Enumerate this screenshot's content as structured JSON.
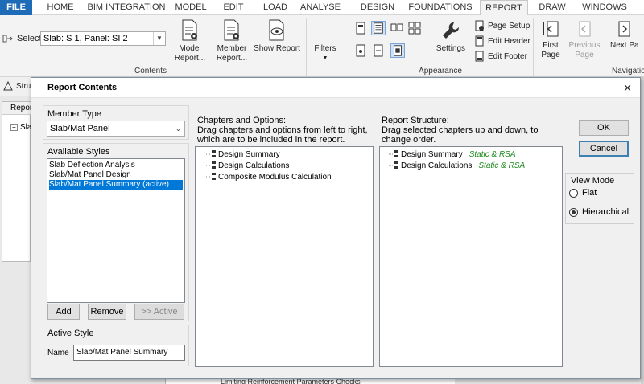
{
  "tabs": [
    "FILE",
    "HOME",
    "BIM INTEGRATION",
    "MODEL",
    "EDIT",
    "LOAD",
    "ANALYSE",
    "DESIGN",
    "FOUNDATIONS",
    "REPORT",
    "DRAW",
    "WINDOWS"
  ],
  "ribbon": {
    "select_label": "Select",
    "select_value": "Slab: S 1, Panel: SI 2",
    "model_report": "Model Report...",
    "member_report": "Member Report...",
    "show_report": "Show Report",
    "contents_group": "Contents",
    "filters": "Filters",
    "settings": "Settings",
    "page_setup": "Page Setup",
    "edit_header": "Edit Header",
    "edit_footer": "Edit Footer",
    "appearance_group": "Appearance",
    "first_page": "First Page",
    "previous_page": "Previous Page",
    "next_page": "Next Pa",
    "navigation_group": "Navigatio"
  },
  "background": {
    "tab_label": "Stru",
    "panel_label": "Repor",
    "tree_item": "Slab",
    "bottom_text": "Limiting Reinforcement Parameters Checks"
  },
  "dialog": {
    "title": "Report Contents",
    "member_type_label": "Member Type",
    "member_type_value": "Slab/Mat Panel",
    "available_styles_label": "Available Styles",
    "styles": [
      "Slab Deflection Analysis",
      "Slab/Mat Panel Design",
      "Slab/Mat Panel Summary (active)"
    ],
    "add": "Add",
    "remove": "Remove",
    "active_btn": ">> Active",
    "active_style_label": "Active Style",
    "name_label": "Name",
    "name_value": "Slab/Mat Panel Summary",
    "chapters_heading": "Chapters and Options:",
    "chapters_desc": "Drag chapters and options from left to right, which are to be included in the report.",
    "chapters": [
      "Design Summary",
      "Design Calculations",
      "Composite Modulus Calculation"
    ],
    "structure_heading": "Report Structure:",
    "structure_desc": "Drag selected chapters up and down, to change order.",
    "structure": [
      {
        "name": "Design Summary",
        "tag": "Static & RSA"
      },
      {
        "name": "Design Calculations",
        "tag": "Static & RSA"
      }
    ],
    "ok": "OK",
    "cancel": "Cancel",
    "view_mode_label": "View Mode",
    "flat": "Flat",
    "hierarchical": "Hierarchical"
  },
  "colors": {
    "file_tab": "#1e6bb8",
    "selection": "#0078d7",
    "tag": "#1e8a1e"
  }
}
